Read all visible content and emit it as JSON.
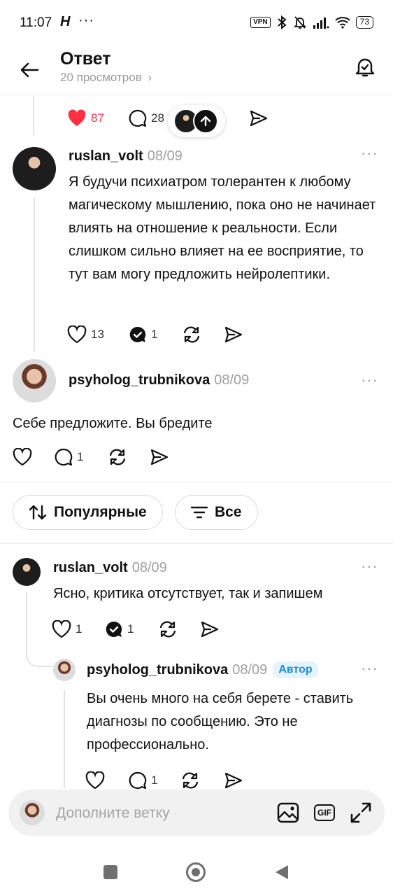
{
  "status_bar": {
    "time": "11:07",
    "carrier_glyph": "H",
    "dots": "···",
    "vpn": "VPN",
    "battery": "73"
  },
  "header": {
    "title": "Ответ",
    "views": "20 просмотров",
    "views_chevron": "›"
  },
  "top_post_actions": {
    "likes": "87",
    "comments": "28",
    "like_color": "#ff3040"
  },
  "post1": {
    "username": "ruslan_volt",
    "date": "08/09",
    "text": "Я будучи психиатром толерантен к любому магическому мышлению, пока оно не начинает влиять на отношение к реальности. Если слишком сильно влияет на ее восприятие, то тут вам могу предложить нейролептики.",
    "likes": "13",
    "replies": "1"
  },
  "post2": {
    "username": "psyholog_trubnikova",
    "date": "08/09",
    "text": "Себе предложите. Вы бредите",
    "comments": "1"
  },
  "filters": {
    "sort_label": "Популярные",
    "filter_label": "Все"
  },
  "reply1": {
    "username": "ruslan_volt",
    "date": "08/09",
    "text": "Ясно, критика отсутствует, так и запишем",
    "likes": "1",
    "replies": "1"
  },
  "reply2": {
    "username": "psyholog_trubnikova",
    "date": "08/09",
    "badge": "Автор",
    "text": "Вы очень много на себя берете - ставить диагнозы по сообщению. Это не профессионально.",
    "comments": "1"
  },
  "composer": {
    "placeholder": "Дополните ветку",
    "gif_label": "GIF"
  },
  "more_glyph": "···",
  "icons": {
    "back": "arrow-left-icon",
    "notify": "bell-check-icon",
    "like": "heart-icon",
    "comment": "comment-icon",
    "repost": "repost-icon",
    "share": "send-icon",
    "sort": "sort-arrows-icon",
    "filter": "filter-lines-icon",
    "image": "image-icon",
    "expand": "expand-icon"
  }
}
